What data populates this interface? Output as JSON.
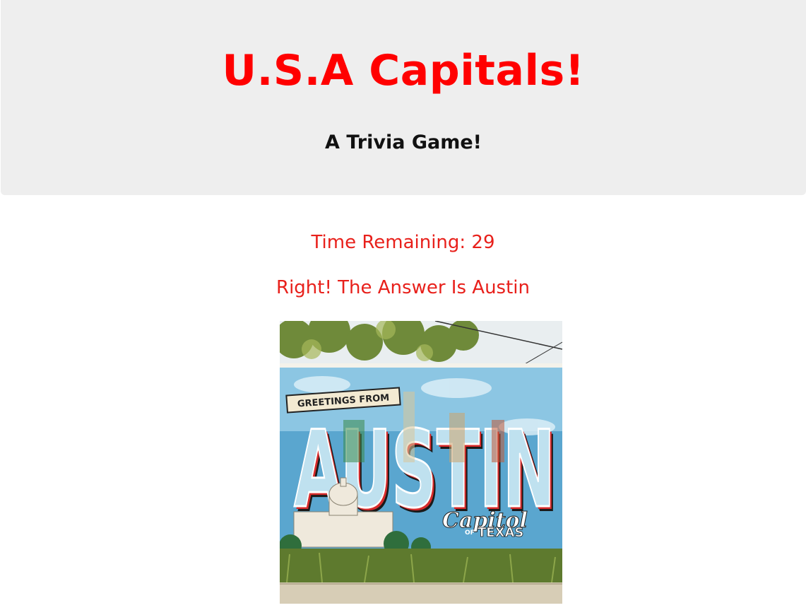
{
  "header": {
    "title": "U.S.A Capitals!",
    "subtitle": "A Trivia Game!"
  },
  "game": {
    "timer_label": "Time Remaining: 29",
    "result_message": "Right! The Answer Is Austin"
  },
  "image": {
    "lettering": {
      "greeting": "GREETINGS FROM",
      "city": "AUSTIN",
      "script": "Capitol",
      "of": "OF",
      "state": "TEXAS"
    }
  },
  "colors": {
    "accent": "#ff0000",
    "header_bg": "#eeeeee",
    "status_text": "#e8201b"
  }
}
